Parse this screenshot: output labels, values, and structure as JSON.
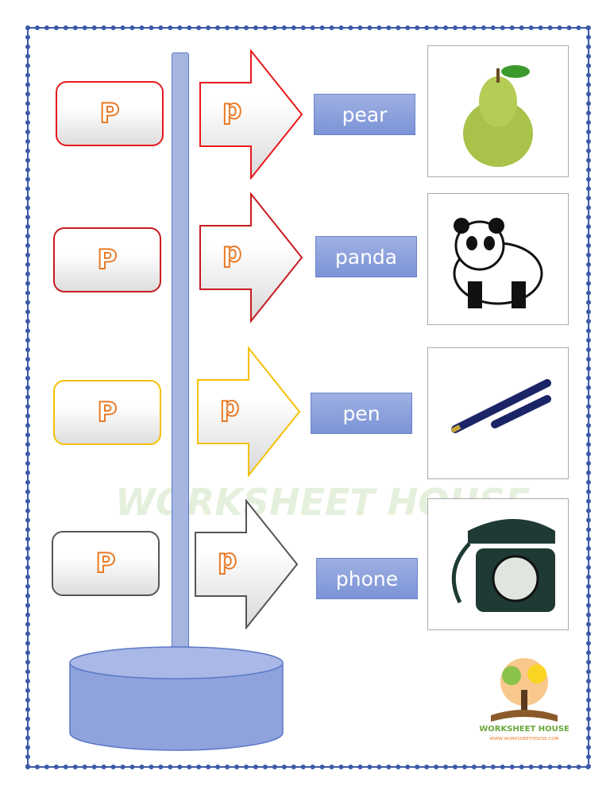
{
  "rows": [
    {
      "upper": "P",
      "lower": "p",
      "word": "pear",
      "color": "#e8191c",
      "image": "pear"
    },
    {
      "upper": "P",
      "lower": "p",
      "word": "panda",
      "color": "#c81a1f",
      "image": "panda"
    },
    {
      "upper": "P",
      "lower": "p",
      "word": "pen",
      "color": "#f5c000",
      "image": "fountain-pen"
    },
    {
      "upper": "P",
      "lower": "p",
      "word": "phone",
      "color": "#555555",
      "image": "rotary-phone"
    }
  ],
  "watermark": "WORKSHEET HOUSE",
  "logo": {
    "name": "WORKSHEET HOUSE",
    "url": "WWW.WORKSHEETHOUSE.COM"
  }
}
